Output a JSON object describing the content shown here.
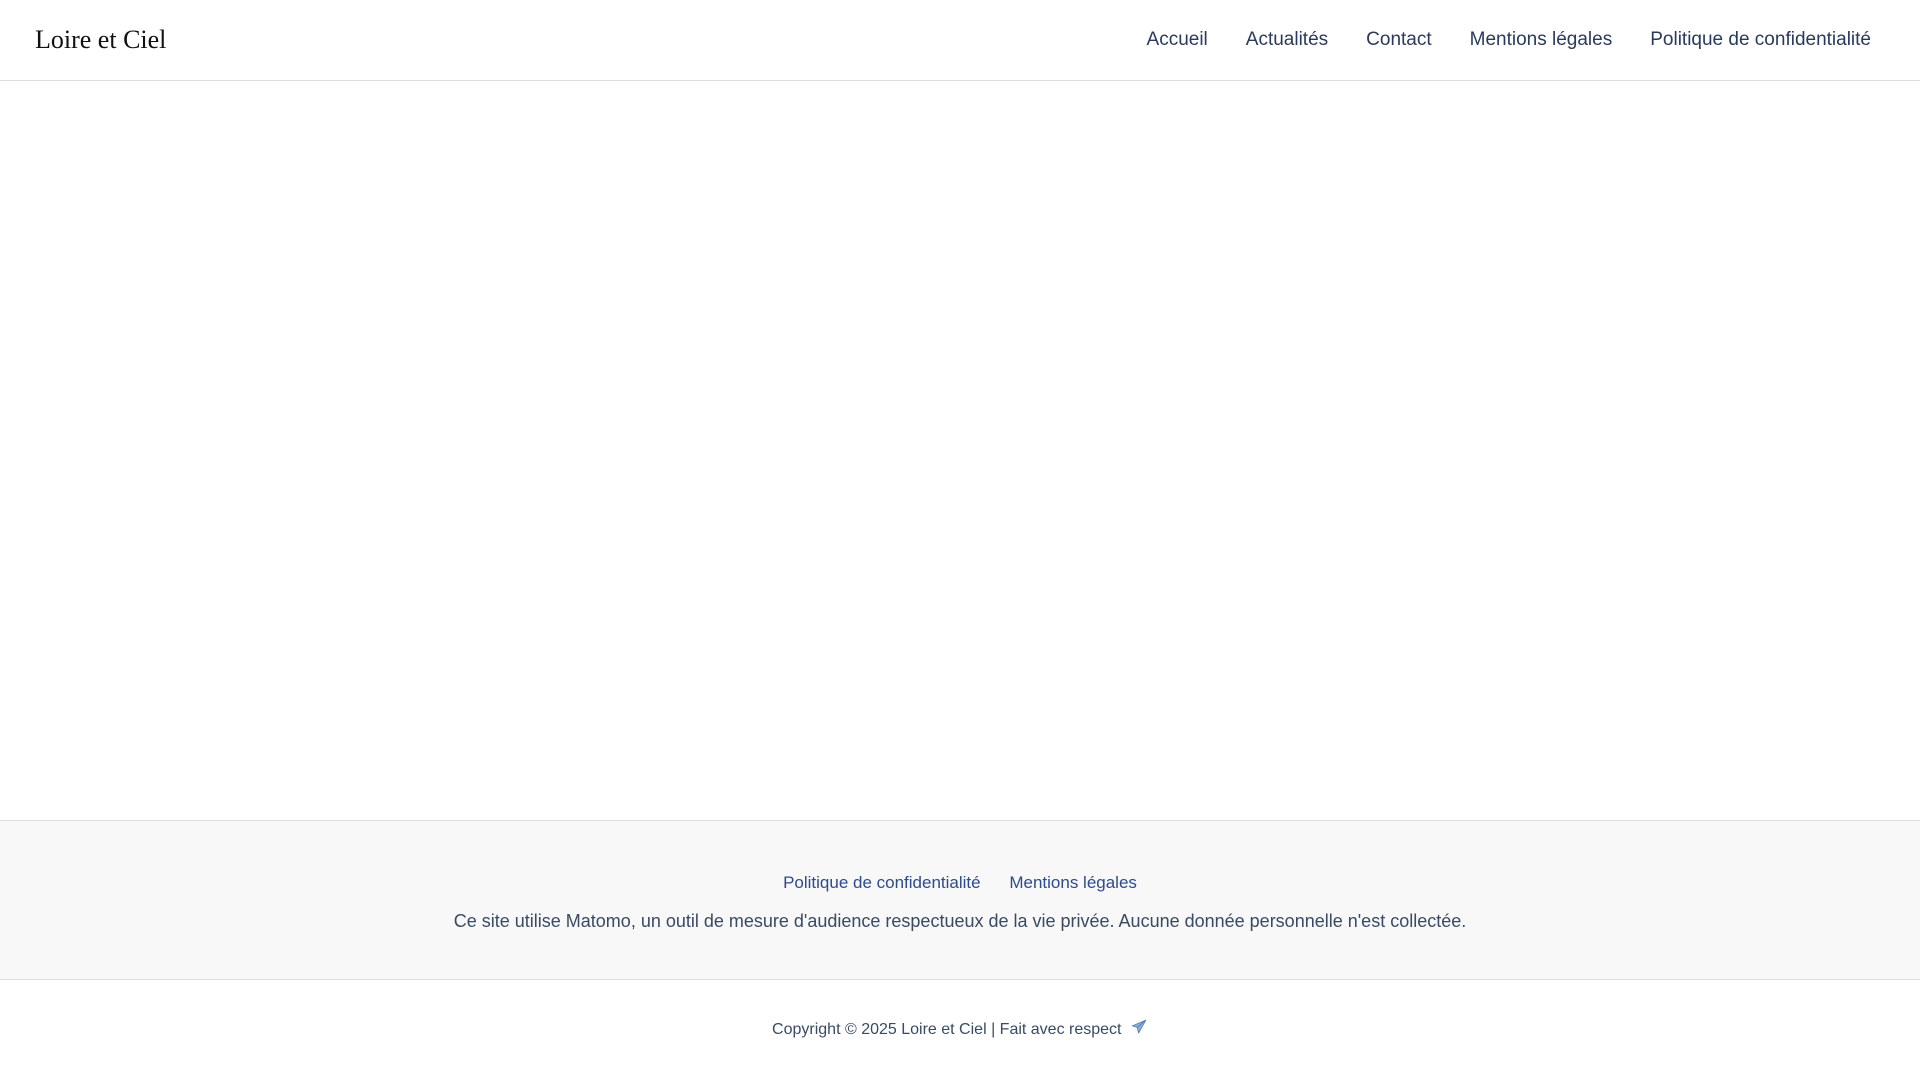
{
  "header": {
    "site_title": "Loire et Ciel",
    "nav": [
      {
        "label": "Accueil"
      },
      {
        "label": "Actualités"
      },
      {
        "label": "Contact"
      },
      {
        "label": "Mentions légales"
      },
      {
        "label": "Politique de confidentialité"
      }
    ]
  },
  "footer": {
    "links": [
      {
        "label": "Politique de confidentialité"
      },
      {
        "label": "Mentions légales"
      }
    ],
    "notice": "Ce site utilise Matomo, un outil de mesure d'audience respectueux de la vie privée. Aucune donnée personnelle n'est collectée.",
    "copyright": "Copyright © 2025 Loire et Ciel | Fait avec respect",
    "copyright_icon": "airplane-icon"
  },
  "colors": {
    "nav_text": "#2a3a5c",
    "footer_link": "#2d4a8a",
    "footer_bg": "#f8f8f8",
    "border": "#dddddd"
  }
}
